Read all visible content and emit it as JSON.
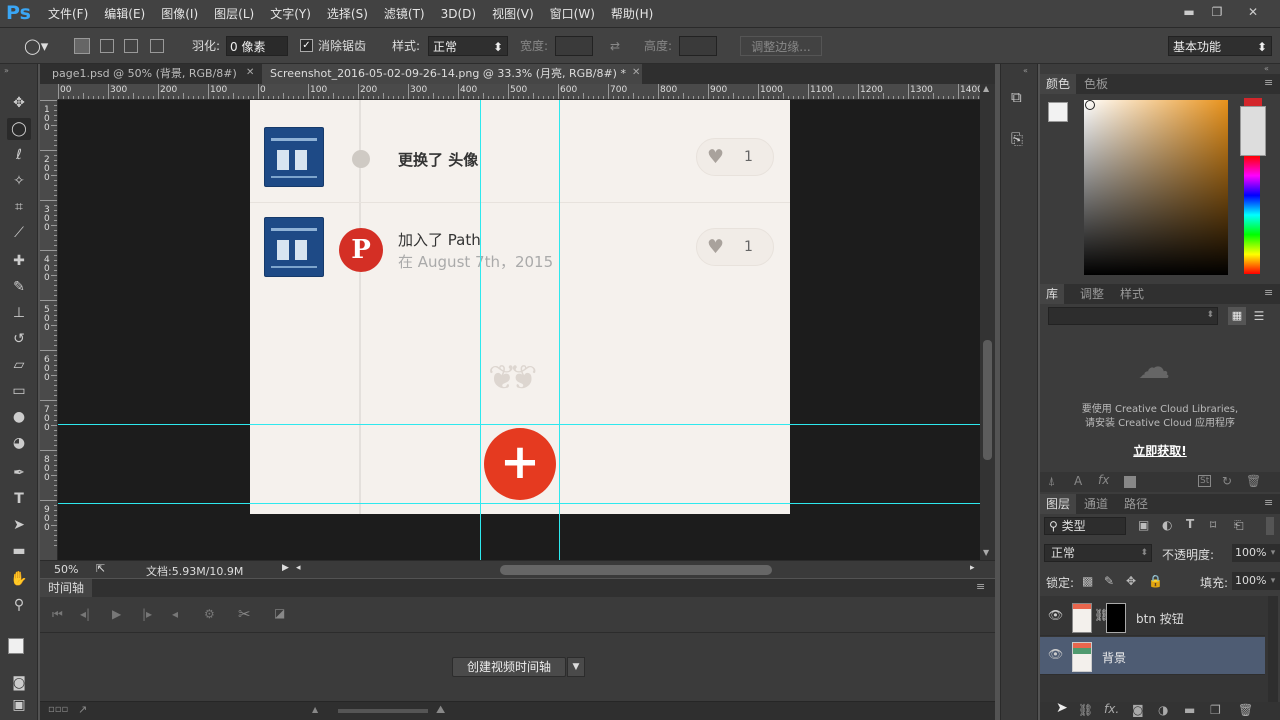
{
  "app": {
    "logo": "Ps"
  },
  "menu": [
    "文件(F)",
    "编辑(E)",
    "图像(I)",
    "图层(L)",
    "文字(Y)",
    "选择(S)",
    "滤镜(T)",
    "3D(D)",
    "视图(V)",
    "窗口(W)",
    "帮助(H)"
  ],
  "window_controls": {
    "minimize": "▬",
    "restore": "❐",
    "close": "✕"
  },
  "options": {
    "feather_label": "羽化:",
    "feather_value": "0 像素",
    "antialias_label": "消除锯齿",
    "antialias_checked": true,
    "style_label": "样式:",
    "style_value": "正常",
    "width_label": "宽度:",
    "height_label": "高度:",
    "refine_edge": "调整边缘...",
    "workspace": "基本功能"
  },
  "tabs": [
    {
      "label": "page1.psd @ 50% (背景, RGB/8#)",
      "active": false
    },
    {
      "label": "Screenshot_2016-05-02-09-26-14.png @ 33.3% (月亮, RGB/8#) *",
      "active": true
    }
  ],
  "ruler_top": [
    "00",
    "300",
    "200",
    "100",
    "0",
    "100",
    "200",
    "300",
    "400",
    "500",
    "600",
    "700",
    "800",
    "900",
    "1000",
    "1100",
    "1200",
    "1300",
    "1400"
  ],
  "ruler_left": [
    "100",
    "200",
    "300",
    "400",
    "500",
    "600",
    "700",
    "800",
    "900"
  ],
  "feed": [
    {
      "action": "更换了 头像",
      "date": "",
      "likes": "1",
      "badge": "dot"
    },
    {
      "action": "加入了 Path",
      "date": "在 August 7th，2015",
      "likes": "1",
      "badge": "pinterest"
    }
  ],
  "fab_symbol": "+",
  "ornament": "❦",
  "status": {
    "zoom": "50%",
    "doc": "文档:5.93M/10.9M"
  },
  "timeline": {
    "title": "时间轴",
    "create_button": "创建视频时间轴"
  },
  "color_panel": {
    "tabs": [
      "颜色",
      "色板"
    ],
    "accent": "#e8921b"
  },
  "library_panel": {
    "tabs": [
      "库",
      "调整",
      "样式"
    ],
    "message_line1": "要使用 Creative Cloud Libraries,",
    "message_line2": "请安装 Creative Cloud 应用程序",
    "link": "立即获取!"
  },
  "layers_panel": {
    "tabs": [
      "图层",
      "通道",
      "路径"
    ],
    "filter": "类型",
    "blend_mode": "正常",
    "opacity_label": "不透明度:",
    "opacity_value": "100%",
    "lock_label": "锁定:",
    "fill_label": "填充:",
    "fill_value": "100%",
    "layers": [
      {
        "name": "btn 按钮",
        "selected": false
      },
      {
        "name": "背景",
        "selected": true
      }
    ],
    "bottom_fx": "fx."
  },
  "colors": {
    "fab": "#e53a20",
    "pinterest": "#d42f25",
    "guide": "#2ee8ee"
  }
}
